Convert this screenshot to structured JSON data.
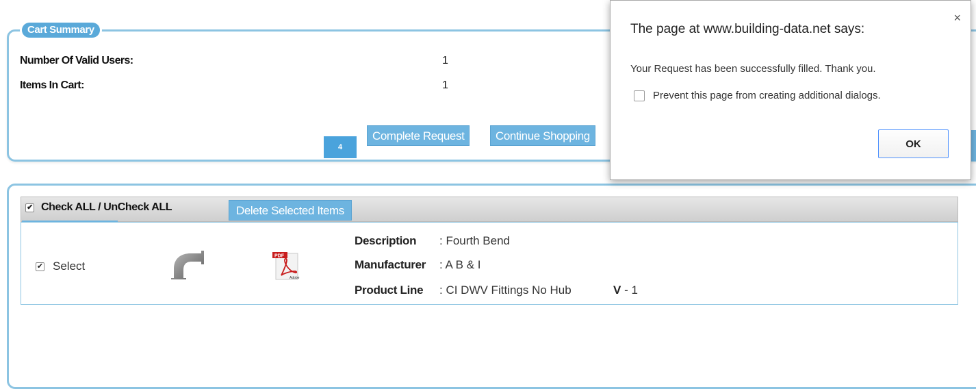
{
  "summary": {
    "legend": "Cart Summary",
    "rows": [
      {
        "label": "Number Of Valid Users:",
        "value": "1"
      },
      {
        "label": "Items In Cart:",
        "value": "1"
      }
    ],
    "badge": "4",
    "complete_label": "Complete Request",
    "continue_label": "Continue Shopping"
  },
  "items": {
    "check_all_label": "Check ALL / UnCheck ALL",
    "delete_label": "Delete Selected Items",
    "row": {
      "select_label": "Select",
      "description_label": "Description",
      "description_value": ": Fourth Bend",
      "manufacturer_label": "Manufacturer",
      "manufacturer_value": ": A B & I",
      "product_line_label": "Product Line",
      "product_line_value": ": CI DWV Fittings No Hub",
      "version_label": "V",
      "version_value": " - 1",
      "pdf_tag": "PDF",
      "pdf_brand": "Adobe"
    }
  },
  "dialog": {
    "title": "The page at www.building-data.net says:",
    "close": "×",
    "message": "Your Request has been successfully filled. Thank you.",
    "prevent_label": "Prevent this page from creating additional dialogs.",
    "ok_label": "OK"
  },
  "colors": {
    "accent": "#6db4e0",
    "border": "#8cc4e2",
    "badge": "#4aa3dc"
  }
}
